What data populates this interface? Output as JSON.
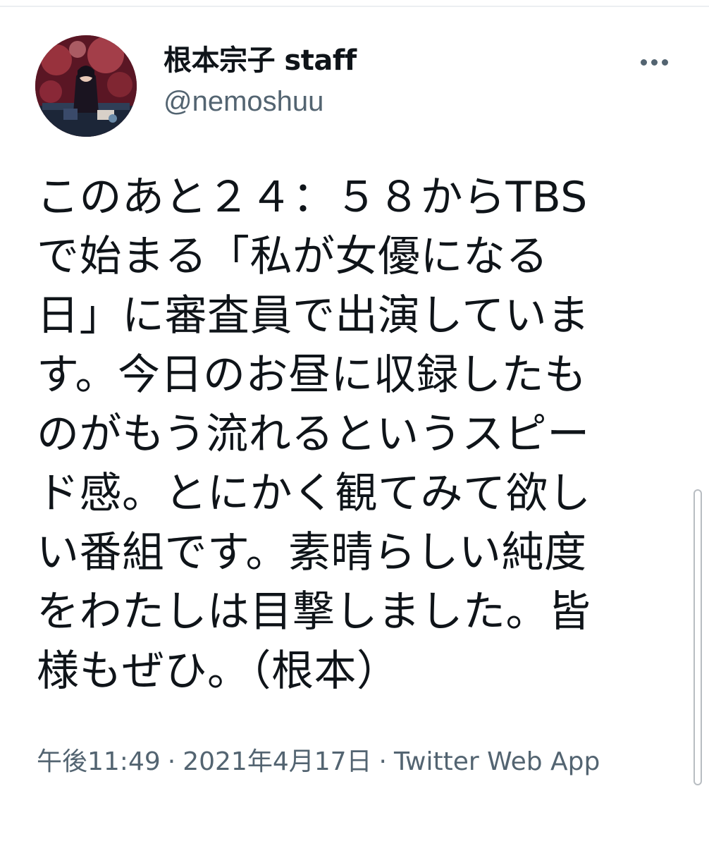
{
  "tweet": {
    "display_name": "根本宗子 staff",
    "handle": "@nemoshuu",
    "more_icon": "more-horizontal-icon",
    "text_lines": [
      "このあと２４：５８からTBS",
      "で始まる「私が女優になる",
      "日」に審査員で出演していま",
      "す。今日のお昼に収録したも",
      "のがもう流れるというスピー",
      "ド感。とにかく観てみて欲し",
      "い番組です。素晴らしい純度",
      "をわたしは目撃しました。皆",
      "様もぜひ。（根本）"
    ],
    "time": "午後11:49",
    "date": "2021年4月17日",
    "source": "Twitter Web App",
    "separator": "·"
  },
  "colors": {
    "text_primary": "#0f1419",
    "text_secondary": "#536471"
  }
}
